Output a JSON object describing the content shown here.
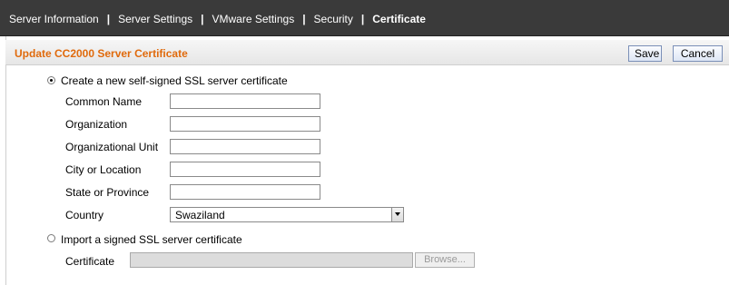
{
  "nav": {
    "items": [
      {
        "label": "Server Information"
      },
      {
        "label": "Server Settings"
      },
      {
        "label": "VMware Settings"
      },
      {
        "label": "Security"
      },
      {
        "label": "Certificate"
      }
    ],
    "separator": "|",
    "active_index": 4
  },
  "header": {
    "title": "Update CC2000 Server Certificate",
    "save_label": "Save",
    "cancel_label": "Cancel",
    "title_color": "#e06a0c"
  },
  "form": {
    "option_self_signed": "Create a new self-signed SSL server certificate",
    "fields": [
      {
        "label": "Common Name",
        "value": ""
      },
      {
        "label": "Organization",
        "value": ""
      },
      {
        "label": "Organizational Unit",
        "value": ""
      },
      {
        "label": "City or Location",
        "value": ""
      },
      {
        "label": "State or Province",
        "value": ""
      }
    ],
    "country_label": "Country",
    "country_value": "Swaziland",
    "option_import": "Import a signed SSL server certificate",
    "certificate_label": "Certificate",
    "browse_label": "Browse...",
    "selected_option": "self-signed"
  }
}
